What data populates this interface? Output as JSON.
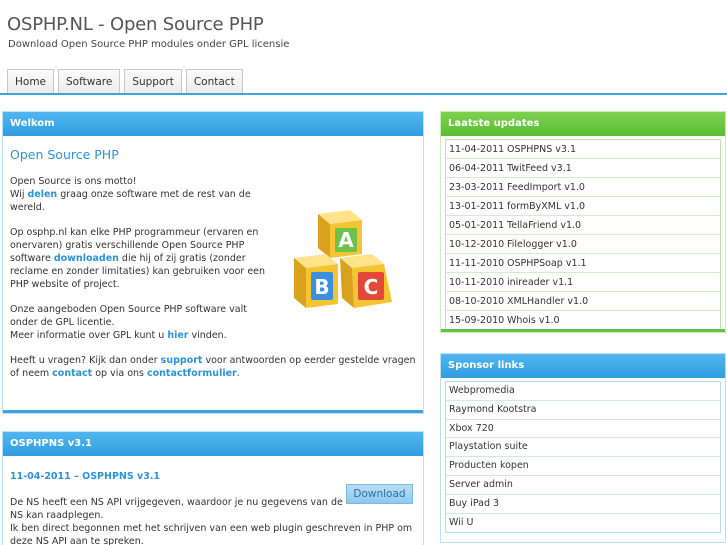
{
  "site": {
    "title": "OSPHP.NL - Open Source PHP",
    "subtitle": "Download Open Source PHP modules onder GPL licensie"
  },
  "nav": [
    "Home",
    "Software",
    "Support",
    "Contact"
  ],
  "welcome": {
    "header": "Welkom",
    "heading": "Open Source PHP",
    "p1_line1": "Open Source is ons motto!",
    "p1_pre": "Wij ",
    "p1_link": "delen",
    "p1_post": " graag onze software met de rest van de wereld.",
    "p2_pre": "Op osphp.nl kan elke PHP programmeur (ervaren en onervaren) gratis verschillende Open Source PHP software ",
    "p2_link": "downloaden",
    "p2_post": " die hij of zij gratis (zonder reclame en zonder limitaties) kan gebruiken voor een PHP website of project.",
    "p3_line1": "Onze aangeboden Open Source PHP software valt onder de GPL licentie.",
    "p3_pre": "Meer informatie over GPL kunt u ",
    "p3_link": "hier",
    "p3_post": " vinden.",
    "p4_pre": "Heeft u vragen? Kijk dan onder ",
    "p4_link1": "support",
    "p4_mid": " voor antwoorden op eerder gestelde vragen of neem ",
    "p4_link2": "contact",
    "p4_mid2": " op via ons ",
    "p4_link3": "contactformulier",
    "p4_post": ".",
    "blocks": [
      "A",
      "B",
      "C"
    ],
    "block_colors": {
      "a": "#6cc24a",
      "b": "#3b8fe0",
      "c": "#e2493b",
      "cube": "#f4c531"
    }
  },
  "osphpns": {
    "header": "OSPHPNS v3.1",
    "date_title": "11-04-2011 – OSPHPNS v3.1",
    "p1": "De NS heeft een NS API vrijgegeven, waardoor je nu gegevens van de NS kan raadplegen.",
    "p2": "Ik ben direct begonnen met het schrijven van een web plugin geschreven in PHP om deze NS API aan te spreken.",
    "download_label": "Download"
  },
  "updates": {
    "header": "Laatste updates",
    "items": [
      {
        "date": "11-04-2011",
        "name": "OSPHPNS v3.1"
      },
      {
        "date": "06-04-2011",
        "name": "TwitFeed v3.1"
      },
      {
        "date": "23-03-2011",
        "name": "FeedImport v1.0"
      },
      {
        "date": "13-01-2011",
        "name": "formByXML v1.0"
      },
      {
        "date": "05-01-2011",
        "name": "TellaFriend v1.0"
      },
      {
        "date": "10-12-2010",
        "name": "Filelogger v1.0"
      },
      {
        "date": "11-11-2010",
        "name": "OSPHPSoap v1.1"
      },
      {
        "date": "10-11-2010",
        "name": "inireader v1.1"
      },
      {
        "date": "08-10-2010",
        "name": "XMLHandler v1.0"
      },
      {
        "date": "15-09-2010",
        "name": "Whois v1.0"
      }
    ]
  },
  "sponsors": {
    "header": "Sponsor links",
    "items": [
      "Webpromedia",
      "Raymond Kootstra",
      "Xbox 720",
      "Playstation suite",
      "Producten kopen",
      "Server admin",
      "Buy iPad 3",
      "Wii U"
    ]
  },
  "colors": {
    "accent_blue": "#3ea3e0",
    "accent_green": "#64c23c",
    "link": "#2b93d6"
  }
}
